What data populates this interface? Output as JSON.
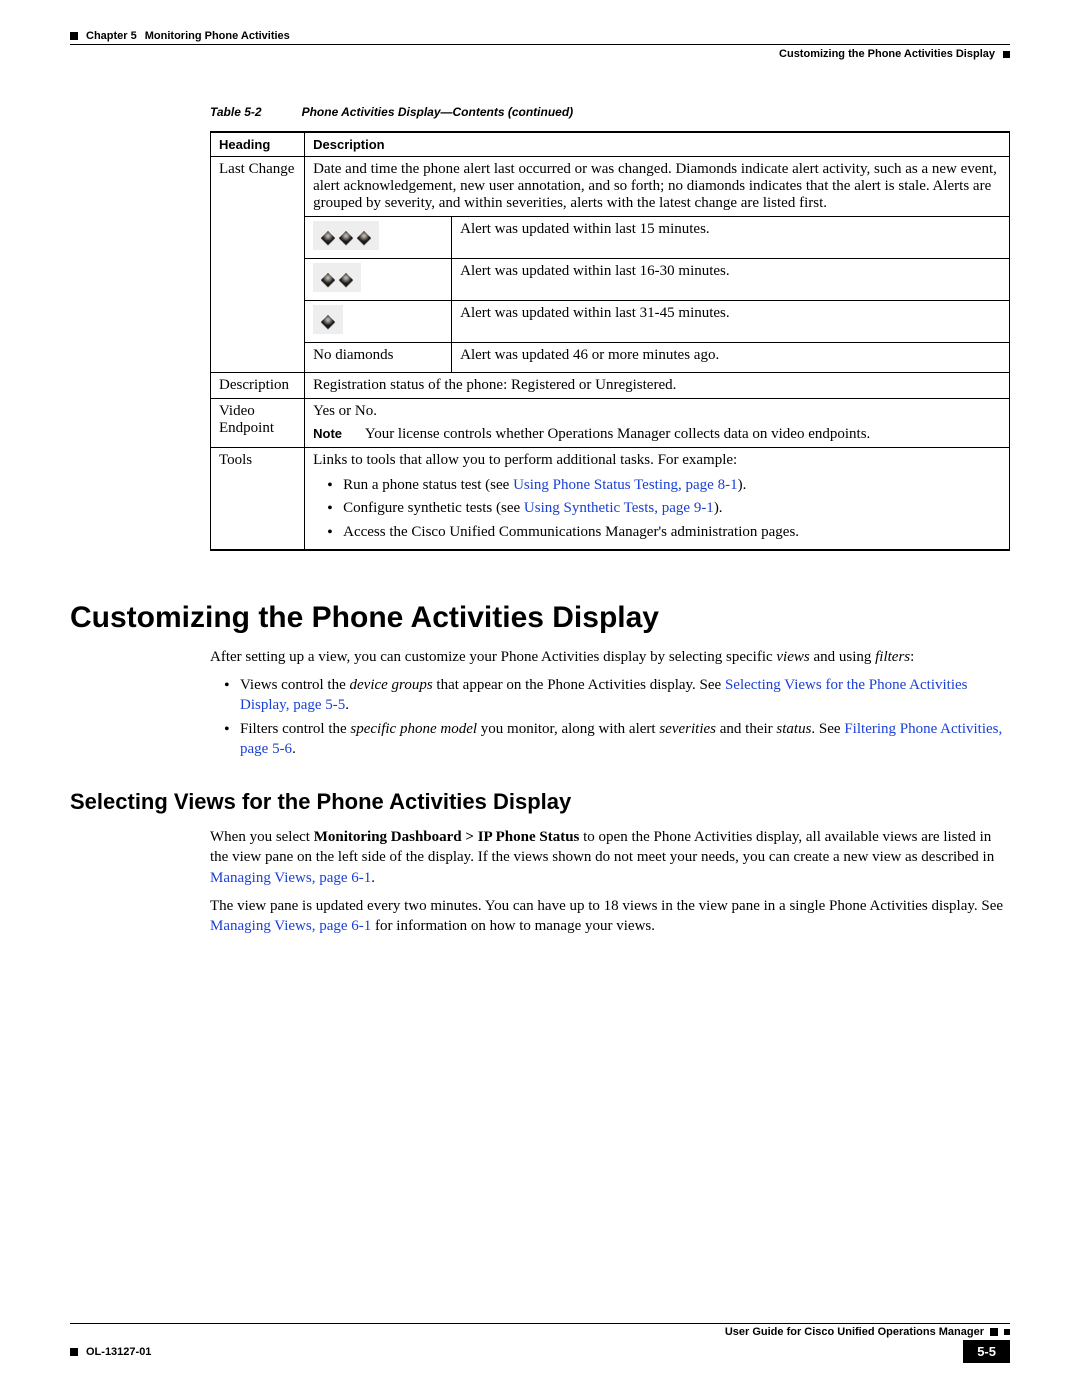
{
  "header": {
    "chapter": "Chapter 5",
    "title": "Monitoring Phone Activities",
    "section": "Customizing the Phone Activities Display"
  },
  "table": {
    "caption_num": "Table 5-2",
    "caption_text": "Phone Activities Display—Contents (continued)",
    "col1": "Heading",
    "col2": "Description",
    "row_lastchange": {
      "heading": "Last Change",
      "desc": "Date and time the phone alert last occurred or was changed. Diamonds indicate alert activity, such as a new event, alert acknowledgement, new user annotation, and so forth; no diamonds indicates that the alert is stale. Alerts are grouped by severity, and within severities, alerts with the latest change are listed first.",
      "d3": "Alert was updated within last 15 minutes.",
      "d2": "Alert was updated within last 16-30 minutes.",
      "d1": "Alert was updated within last 31-45 minutes.",
      "no_diamonds_label": "No diamonds",
      "d0": "Alert was updated 46 or more minutes ago."
    },
    "row_description": {
      "heading": "Description",
      "desc": "Registration status of the phone: Registered or Unregistered."
    },
    "row_video": {
      "heading": "Video Endpoint",
      "desc": "Yes or No.",
      "note_label": "Note",
      "note_text": "Your license controls whether Operations Manager collects data on video endpoints."
    },
    "row_tools": {
      "heading": "Tools",
      "desc": "Links to tools that allow you to perform additional tasks. For example:",
      "b1_pre": "Run a phone status test (see ",
      "b1_link": "Using Phone Status Testing, page 8-1",
      "b1_post": ").",
      "b2_pre": "Configure synthetic tests (see ",
      "b2_link": "Using Synthetic Tests, page 9-1",
      "b2_post": ").",
      "b3": "Access the Cisco Unified Communications Manager's administration pages."
    }
  },
  "section1": {
    "title": "Customizing the Phone Activities Display",
    "p1_pre": "After setting up a view, you can customize your Phone Activities display by selecting specific ",
    "p1_i1": "views",
    "p1_mid": " and using ",
    "p1_i2": "filters",
    "p1_post": ":",
    "b1_pre": "Views control the ",
    "b1_i": "device groups",
    "b1_mid": " that appear on the Phone Activities display. See ",
    "b1_link": "Selecting Views for the Phone Activities Display, page 5-5",
    "b1_post": ".",
    "b2_pre": "Filters control the ",
    "b2_i1": "specific phone model",
    "b2_mid1": " you monitor, along with alert ",
    "b2_i2": "severities",
    "b2_mid2": " and their ",
    "b2_i3": "status",
    "b2_mid3": ". See ",
    "b2_link": "Filtering Phone Activities, page 5-6",
    "b2_post": "."
  },
  "section2": {
    "title": "Selecting Views for the Phone Activities Display",
    "p1_pre": "When you select ",
    "p1_b": "Monitoring Dashboard > IP Phone Status",
    "p1_mid": " to open the Phone Activities display, all available views are listed in the view pane on the left side of the display. If the views shown do not meet your needs, you can create a new view as described in ",
    "p1_link": "Managing Views, page 6-1",
    "p1_post": ".",
    "p2_pre": "The view pane is updated every two minutes. You can have up to 18 views in the view pane in a single Phone Activities display. See ",
    "p2_link": "Managing Views, page 6-1",
    "p2_post": " for information on how to manage your views."
  },
  "footer": {
    "guide": "User Guide for Cisco Unified Operations Manager",
    "doc": "OL-13127-01",
    "page": "5-5"
  }
}
